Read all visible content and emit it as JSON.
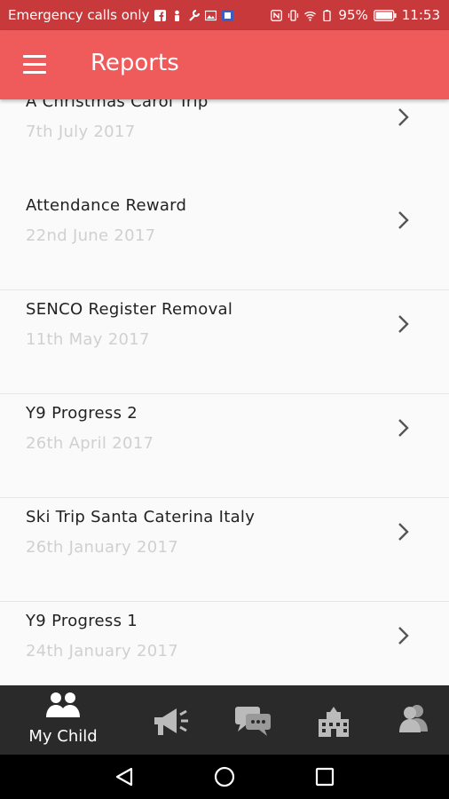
{
  "status_bar": {
    "carrier_text": "Emergency calls only",
    "battery": "95%",
    "time": "11:53"
  },
  "app_bar": {
    "title": "Reports"
  },
  "reports": [
    {
      "title": "A Christmas Carol Trip",
      "date": "7th July 2017"
    },
    {
      "title": "Attendance Reward",
      "date": "22nd June 2017"
    },
    {
      "title": "SENCO Register Removal",
      "date": "11th May 2017"
    },
    {
      "title": "Y9 Progress 2",
      "date": "26th April 2017"
    },
    {
      "title": "Ski Trip Santa Caterina Italy",
      "date": "26th January 2017"
    },
    {
      "title": "Y9 Progress 1",
      "date": "24th January 2017"
    }
  ],
  "tabs": [
    {
      "label": "My Child",
      "icon": "parents-icon",
      "active": true
    },
    {
      "label": "",
      "icon": "megaphone-icon",
      "active": false
    },
    {
      "label": "",
      "icon": "chat-bubbles-icon",
      "active": false
    },
    {
      "label": "",
      "icon": "school-building-icon",
      "active": false
    },
    {
      "label": "",
      "icon": "contacts-icon",
      "active": false
    }
  ],
  "colors": {
    "status_bar": "#c8393c",
    "app_bar": "#ef5a5b",
    "tab_bar": "#2a2a2a",
    "date_text": "#d0d0d0"
  }
}
